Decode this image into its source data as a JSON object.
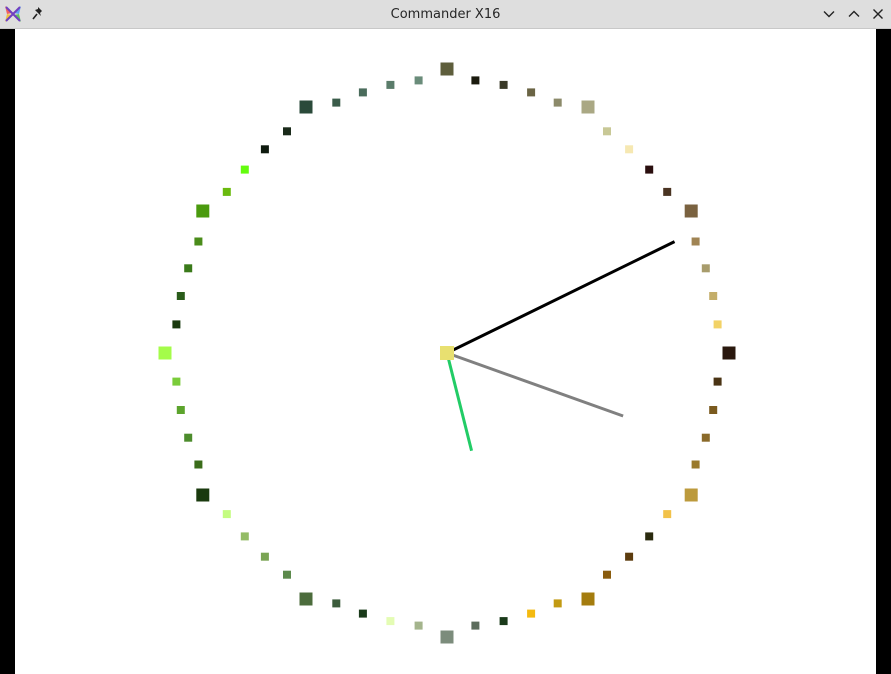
{
  "window": {
    "title": "Commander X16"
  },
  "icons": {
    "app": "x16-logo-icon",
    "pin": "pin-icon",
    "minimize": "chevron-down-icon",
    "maximize": "chevron-up-icon",
    "close": "close-icon"
  },
  "colors": {
    "titlebar": "#dedede",
    "screen_background": "#ffffff",
    "hour_hand": "#000000",
    "minute_hand": "#808080",
    "second_hand": "#22cc66",
    "center_dot": "#e8e070"
  },
  "clock": {
    "dial_marks": [
      "#5e5e3c",
      "#1a1a0e",
      "#3a3a28",
      "#6a6444",
      "#8c8a6a",
      "#aaa884",
      "#c8c896",
      "#f6e8b2",
      "#2a0e0e",
      "#4a3422",
      "#7a6240",
      "#a08454",
      "#a89c6c",
      "#c4ae6a",
      "#f2d266",
      "#2a180e",
      "#4a3414",
      "#7a5a1e",
      "#8a6a2a",
      "#9a7a2c",
      "#bc9a3c",
      "#f2c24a",
      "#2a2a0e",
      "#5c3c0e",
      "#8a5c0e",
      "#a47c0e",
      "#c29a12",
      "#f4ba10",
      "#1a3a1a",
      "#5c6c5c",
      "#7c8c7c",
      "#a4b48c",
      "#e4fcb4",
      "#1a3a1a",
      "#3c5c3c",
      "#4c6c3c",
      "#5c8a4c",
      "#7aa454",
      "#94bc66",
      "#c4fc80",
      "#1a3a0e",
      "#3a6c1a",
      "#4c8c2c",
      "#5ca42c",
      "#7acc3a",
      "#a4fc4a",
      "#1a3a0e",
      "#2a5c1a",
      "#3a7a1a",
      "#4a8c1a",
      "#4a9a0e",
      "#6aba0e",
      "#64fc0e",
      "#0e1a0e",
      "#1a2a1a",
      "#2a4a3a",
      "#3a5c4a",
      "#4a6c5c",
      "#5a7c6a",
      "#6a8c7a"
    ],
    "hour_value": 10.8,
    "minute_value": 18.2,
    "second_value": 27.4
  }
}
